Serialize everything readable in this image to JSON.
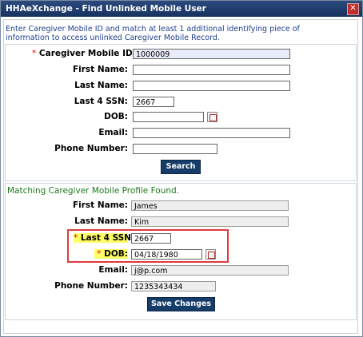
{
  "window": {
    "title": "HHAeXchange - Find Unlinked Mobile User",
    "close_glyph": "✕"
  },
  "instructions": "Enter Caregiver Mobile ID and match at least 1 additional identifying piece of information to access unlinked Caregiver Mobile Record.",
  "search_form": {
    "required_mark": "*",
    "mobile_id_label": "Caregiver Mobile ID:",
    "mobile_id_value": "1000009",
    "first_name_label": "First Name:",
    "first_name_value": "",
    "last_name_label": "Last Name:",
    "last_name_value": "",
    "ssn_label": "Last 4 SSN:",
    "ssn_value": "2667",
    "dob_label": "DOB:",
    "dob_value": "",
    "email_label": "Email:",
    "email_value": "",
    "phone_label": "Phone Number:",
    "phone_value": "",
    "search_button": "Search"
  },
  "result": {
    "message": "Matching Caregiver Mobile Profile Found.",
    "required_mark": "*",
    "first_name_label": "First Name:",
    "first_name_value": "James",
    "last_name_label": "Last Name:",
    "last_name_value": "Kim",
    "ssn_label": "Last 4 SSN:",
    "ssn_value": "2667",
    "dob_label": "DOB:",
    "dob_value": "04/18/1980",
    "email_label": "Email:",
    "email_value": "j@p.com",
    "phone_label": "Phone Number:",
    "phone_value": "1235343434",
    "save_button": "Save Changes"
  },
  "colors": {
    "titlebar": "#17325e",
    "button": "#163d6a",
    "found_text": "#1b7a1b",
    "highlight_box": "#e0393e"
  }
}
